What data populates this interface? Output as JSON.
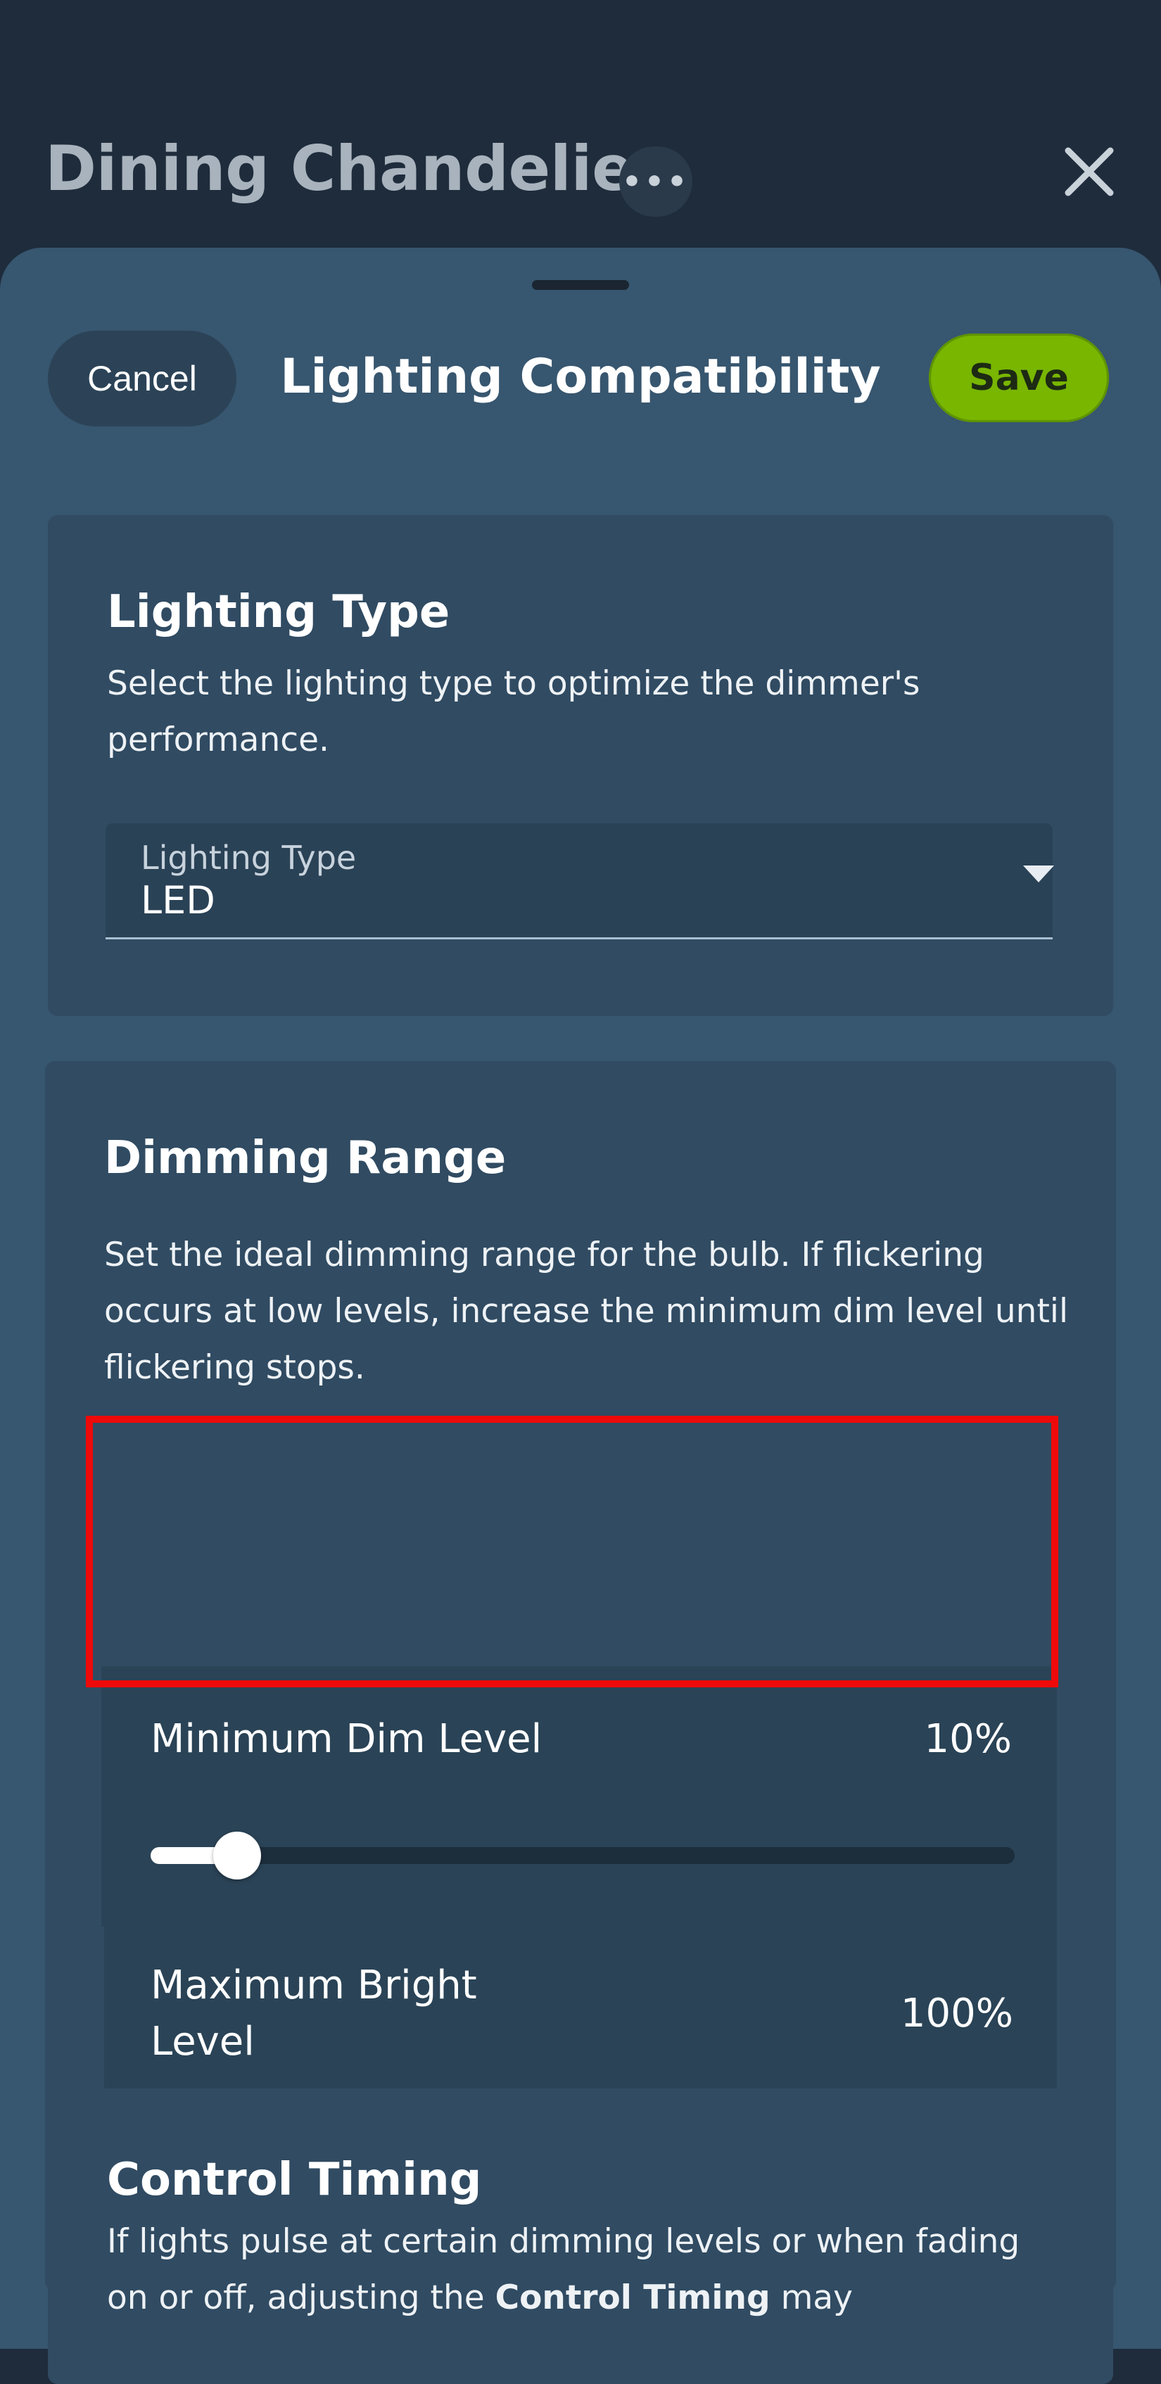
{
  "background": {
    "device_name": "Dining Chandelier",
    "more_label": "•••",
    "close_icon": "close-icon"
  },
  "sheet": {
    "title": "Lighting Compatibility",
    "cancel_label": "Cancel",
    "save_label": "Save",
    "save_color": "#78b600"
  },
  "lighting_type": {
    "title": "Lighting Type",
    "description": "Select the lighting type to optimize the dimmer's performance.",
    "select_label": "Lighting Type",
    "select_value": "LED"
  },
  "dimming_range": {
    "title": "Dimming Range",
    "description": "Set the ideal dimming range for the bulb. If flickering occurs at low levels, increase the minimum dim level until flickering stops.",
    "min": {
      "label": "Minimum Dim Level",
      "value_text": "10%",
      "level": 0.1
    },
    "max": {
      "label": "Maximum Bright Level",
      "value_text": "100%",
      "level": 1.0
    }
  },
  "control_timing": {
    "title": "Control Timing",
    "description_pre": "If lights pulse at certain dimming levels or when fading on or off, adjusting the ",
    "description_bold": "Control Timing",
    "description_post": " may"
  }
}
